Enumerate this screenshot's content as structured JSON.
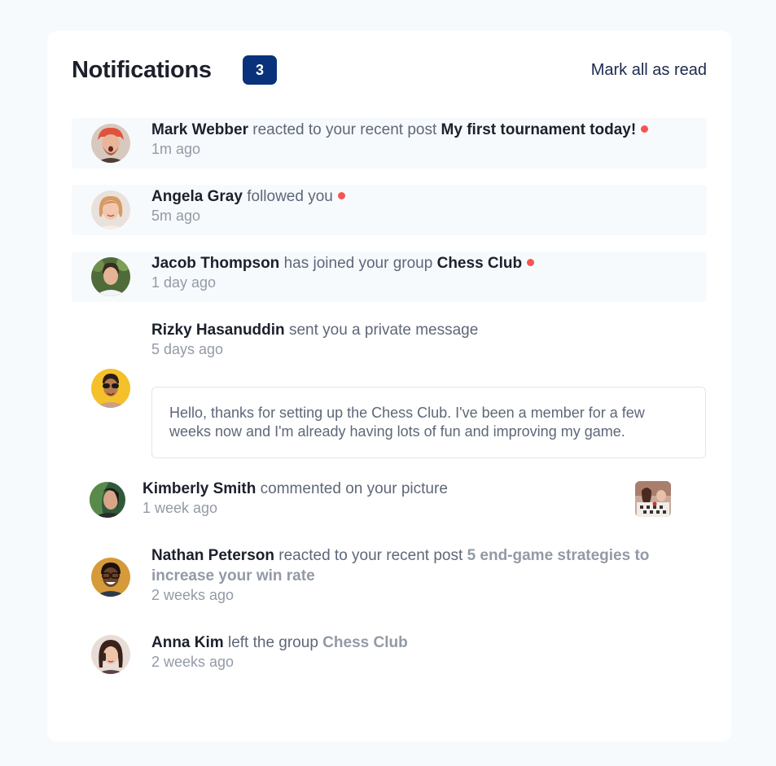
{
  "header": {
    "title": "Notifications",
    "unread_count": "3",
    "mark_all_label": "Mark all as read"
  },
  "notifications": [
    {
      "name": "Mark Webber",
      "action": "reacted to your recent post",
      "target": "My first tournament today!",
      "time": "1m ago",
      "unread": true,
      "avatar_icon": "avatar-mark-webber"
    },
    {
      "name": "Angela Gray",
      "action": "followed you",
      "target": "",
      "time": "5m ago",
      "unread": true,
      "avatar_icon": "avatar-angela-gray"
    },
    {
      "name": "Jacob Thompson",
      "action": "has joined your group",
      "target": "Chess Club",
      "time": "1 day ago",
      "unread": true,
      "avatar_icon": "avatar-jacob-thompson"
    },
    {
      "name": "Rizky Hasanuddin",
      "action": "sent you a private message",
      "time": "5 days ago",
      "message": "Hello, thanks for setting up the Chess Club. I've been a member for a few weeks now and I'm already having lots of fun and improving my game.",
      "unread": false,
      "avatar_icon": "avatar-rizky-hasanuddin"
    },
    {
      "name": "Kimberly Smith",
      "action": "commented on your picture",
      "time": "1 week ago",
      "unread": false,
      "avatar_icon": "avatar-kimberly-smith",
      "picture_icon": "chess-picture-thumbnail"
    },
    {
      "name": "Nathan Peterson",
      "action": "reacted to your recent post",
      "target": "5 end-game strategies to increase your win rate",
      "time": "2 weeks ago",
      "unread": false,
      "avatar_icon": "avatar-nathan-peterson"
    },
    {
      "name": "Anna Kim",
      "action": "left the group",
      "target": "Chess Club",
      "time": "2 weeks ago",
      "unread": false,
      "avatar_icon": "avatar-anna-kim"
    }
  ],
  "colors": {
    "background": "#f7fafd",
    "card": "#ffffff",
    "badge": "#0a327b",
    "unread_dot": "#f65552",
    "text_dark": "#1c202b",
    "text_muted": "#5e6778",
    "text_light": "#939aa6"
  }
}
